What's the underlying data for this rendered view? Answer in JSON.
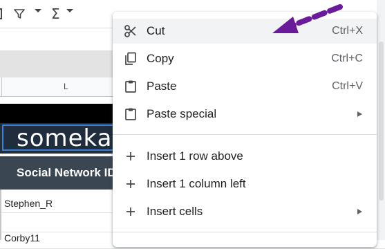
{
  "toolbar": {
    "icons": [
      "filter-icon",
      "sum-icon"
    ],
    "sigma_glyph": "Σ"
  },
  "sheet": {
    "column_label": "L",
    "logo_text": "someka",
    "header_text": "Social Network ID",
    "cells": [
      "Stephen_R",
      "",
      "Corby11"
    ]
  },
  "context_menu": {
    "items": [
      {
        "label": "Cut",
        "shortcut": "Ctrl+X",
        "icon": "scissors-icon",
        "hovered": true
      },
      {
        "label": "Copy",
        "shortcut": "Ctrl+C",
        "icon": "copy-icon"
      },
      {
        "label": "Paste",
        "shortcut": "Ctrl+V",
        "icon": "clipboard-icon"
      },
      {
        "label": "Paste special",
        "shortcut": "",
        "icon": "clipboard-icon",
        "submenu": true
      },
      {
        "label": "Insert 1 row above",
        "shortcut": "",
        "icon": "plus-icon"
      },
      {
        "label": "Insert 1 column left",
        "shortcut": "",
        "icon": "plus-icon"
      },
      {
        "label": "Insert cells",
        "shortcut": "",
        "icon": "plus-icon",
        "submenu": true
      }
    ]
  },
  "colors": {
    "annotation_arrow": "#6a1b9a",
    "header_band": "#3a4651",
    "logo_band": "#1f2d3d"
  }
}
